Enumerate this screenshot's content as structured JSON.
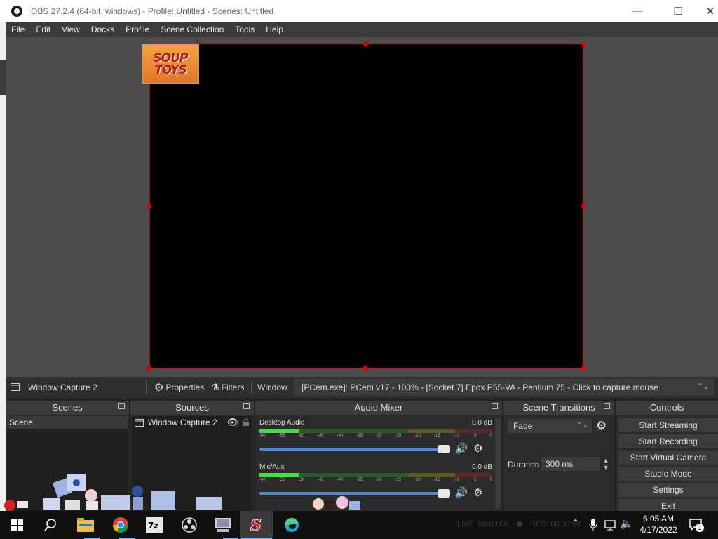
{
  "window": {
    "title": "OBS 27.2.4 (64-bit, windows) - Profile: Untitled - Scenes: Untitled",
    "minimize": "—",
    "maximize": "☐",
    "close": "✕"
  },
  "menu": [
    "File",
    "Edit",
    "View",
    "Docks",
    "Profile",
    "Scene Collection",
    "Tools",
    "Help"
  ],
  "preview": {
    "logo_line1": "SOUP",
    "logo_line2": "TOYS"
  },
  "source_toolbar": {
    "source_name": "Window Capture 2",
    "properties": "Properties",
    "filters": "Filters",
    "window_label": "Window",
    "window_value": "[PCem.exe]: PCem v17 - 100% - [Socket 7] Epox P55-VA - Pentium 75 - Click to capture mouse"
  },
  "docks": {
    "scenes": {
      "title": "Scenes",
      "items": [
        "Scene"
      ]
    },
    "sources": {
      "title": "Sources",
      "items": [
        "Window Capture 2"
      ]
    },
    "mixer": {
      "title": "Audio Mixer",
      "tracks": [
        {
          "name": "Desktop Audio",
          "db": "0.0 dB",
          "level": 0.2
        },
        {
          "name": "Mic/Aux",
          "db": "0.0 dB",
          "level": 0.2
        }
      ],
      "ticks": [
        "-60",
        "-55",
        "-50",
        "-45",
        "-40",
        "-35",
        "-30",
        "-25",
        "-20",
        "-15",
        "-10",
        "-5",
        "0"
      ]
    },
    "transitions": {
      "title": "Scene Transitions",
      "selected": "Fade",
      "duration_label": "Duration",
      "duration_value": "300 ms"
    },
    "controls": {
      "title": "Controls",
      "buttons": [
        "Start Streaming",
        "Start Recording",
        "Start Virtual Camera",
        "Studio Mode",
        "Settings",
        "Exit"
      ]
    }
  },
  "status": {
    "live": "LIVE: 00:00:00",
    "rec": "REC: 00:00:00"
  },
  "taskbar": {
    "time": "6:05 AM",
    "date": "4/17/2022",
    "notifications": "1"
  }
}
